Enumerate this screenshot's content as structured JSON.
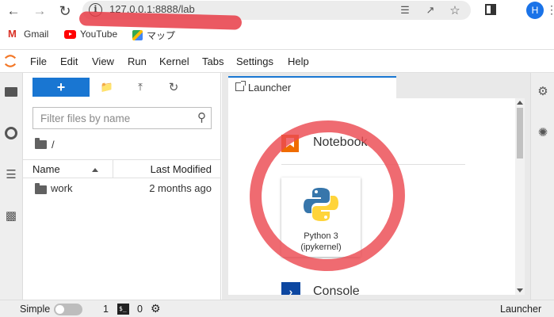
{
  "browser": {
    "url": "127.0.0.1:8888/lab",
    "profile_initial": "H",
    "bookmarks": [
      {
        "label": "Gmail",
        "icon": "gmail-icon"
      },
      {
        "label": "YouTube",
        "icon": "youtube-icon"
      },
      {
        "label": "マップ",
        "icon": "maps-icon"
      }
    ]
  },
  "menu": {
    "items": [
      "File",
      "Edit",
      "View",
      "Run",
      "Kernel",
      "Tabs",
      "Settings",
      "Help"
    ]
  },
  "filebrowser": {
    "new_label": "+",
    "filter_placeholder": "Filter files by name",
    "path": "/",
    "columns": {
      "name": "Name",
      "modified": "Last Modified"
    },
    "rows": [
      {
        "name": "work",
        "modified": "2 months ago"
      }
    ]
  },
  "main": {
    "tab_label": "Launcher",
    "sections": {
      "notebook": "Notebook",
      "console": "Console"
    },
    "kernel_card": {
      "line1": "Python 3",
      "line2": "(ipykernel)"
    }
  },
  "status": {
    "mode": "Simple",
    "count_a": "1",
    "count_b": "0",
    "current_tab": "Launcher"
  },
  "colors": {
    "accent": "#1976d2",
    "notebook_icon": "#ef6c00",
    "annotation": "#ec4a52"
  }
}
